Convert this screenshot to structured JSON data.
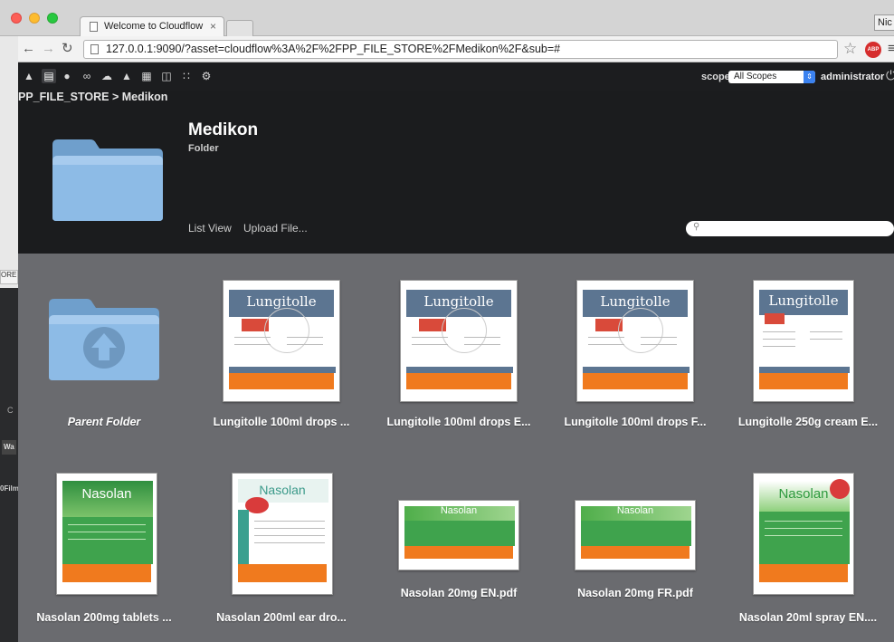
{
  "bg_window": {
    "tab_text": "ORE",
    "c_text": "C",
    "w_text": "Wa",
    "film_text": "0Film"
  },
  "browser": {
    "tab_title": "Welcome to Cloudflow",
    "tab_close": "×",
    "profile": "Nic",
    "url": "127.0.0.1:9090/?asset=cloudflow%3A%2F%2FPP_FILE_STORE%2FMedikon%2F&sub=#",
    "abp": "ABP"
  },
  "appbar": {
    "icons": [
      "home-icon",
      "database-icon",
      "user-icon",
      "link-icon",
      "cloud-icon",
      "hat-icon",
      "grid-icon",
      "columns-icon",
      "apps-icon",
      "gear-icon"
    ],
    "scope_label": "scope",
    "scope_value": "All Scopes",
    "user": "administrator"
  },
  "header": {
    "breadcrumb": "PP_FILE_STORE > Medikon",
    "folder_name": "Medikon",
    "folder_type": "Folder",
    "list_view": "List View",
    "upload": "Upload File...",
    "search_placeholder": ""
  },
  "items": [
    {
      "label": "Parent Folder",
      "kind": "parent"
    },
    {
      "label": "Lungitolle 100ml drops ...",
      "kind": "lungitolle",
      "thumb_title": "Lungitolle"
    },
    {
      "label": "Lungitolle 100ml drops E...",
      "kind": "lungitolle",
      "thumb_title": "Lungitolle"
    },
    {
      "label": "Lungitolle 100ml drops F...",
      "kind": "lungitolle",
      "thumb_title": "Lungitolle"
    },
    {
      "label": "Lungitolle 250g cream E...",
      "kind": "lungitolle",
      "thumb_title": "Lungitolle"
    },
    {
      "label": "Nasolan 200mg tablets ...",
      "kind": "nasolan-tall",
      "thumb_title": "Nasolan"
    },
    {
      "label": "Nasolan 200ml ear dro...",
      "kind": "nasolan-ear",
      "thumb_title": "Nasolan"
    },
    {
      "label": "Nasolan 20mg EN.pdf",
      "kind": "nasolan-wide",
      "thumb_title": "Nasolan"
    },
    {
      "label": "Nasolan 20mg FR.pdf",
      "kind": "nasolan-wide",
      "thumb_title": "Nasolan"
    },
    {
      "label": "Nasolan 20ml spray EN....",
      "kind": "nasolan-spray",
      "thumb_title": "Nasolan"
    }
  ],
  "colors": {
    "app_dark": "#1b1c1e",
    "grid_bg": "#6a6b6f",
    "folder_blue": "#7fb2e0",
    "lungitolle_header": "#5c7591",
    "orange": "#f07a1e",
    "green": "#3fa34d"
  }
}
